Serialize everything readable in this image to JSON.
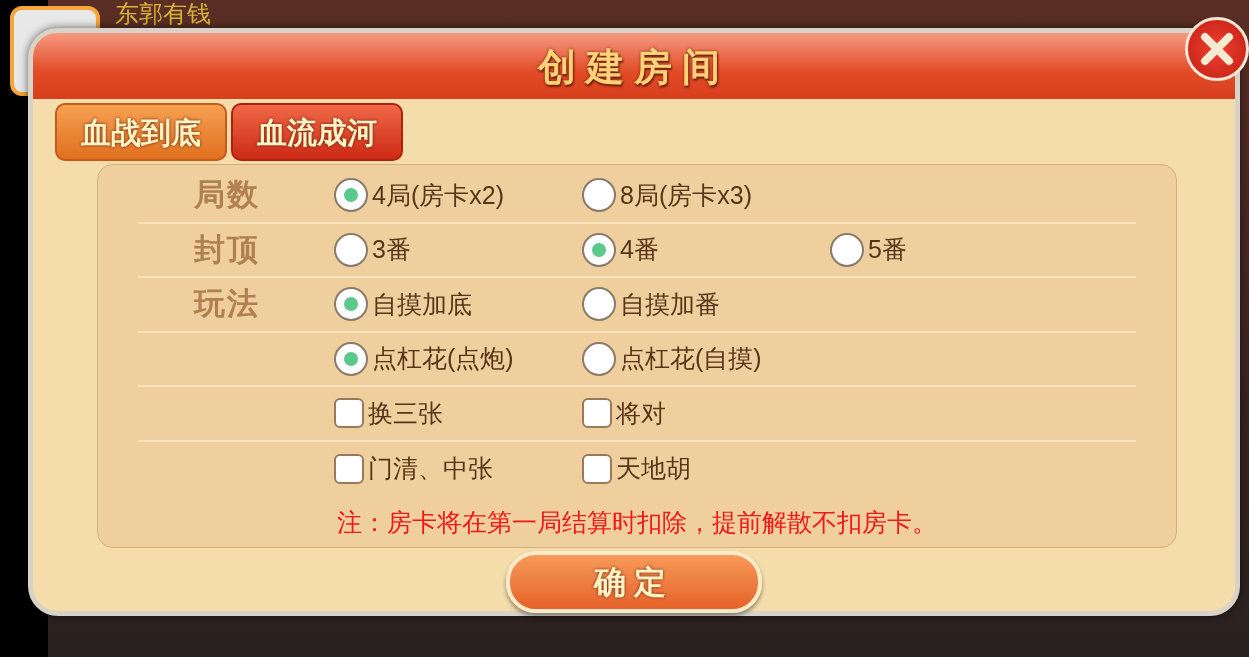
{
  "player": {
    "name": "东郭有钱"
  },
  "dialog": {
    "title": "创建房间",
    "tabs": [
      {
        "label": "血战到底",
        "selected": false
      },
      {
        "label": "血流成河",
        "selected": true
      }
    ],
    "rows": [
      {
        "label": "局数",
        "options": [
          {
            "kind": "radio",
            "label": "4局(房卡x2)",
            "selected": true
          },
          {
            "kind": "radio",
            "label": "8局(房卡x3)",
            "selected": false
          }
        ]
      },
      {
        "label": "封顶",
        "options": [
          {
            "kind": "radio",
            "label": "3番",
            "selected": false
          },
          {
            "kind": "radio",
            "label": "4番",
            "selected": true
          },
          {
            "kind": "radio",
            "label": "5番",
            "selected": false
          }
        ]
      },
      {
        "label": "玩法",
        "options": [
          {
            "kind": "radio",
            "label": "自摸加底",
            "selected": true
          },
          {
            "kind": "radio",
            "label": "自摸加番",
            "selected": false
          }
        ]
      },
      {
        "options": [
          {
            "kind": "radio",
            "label": "点杠花(点炮)",
            "selected": true
          },
          {
            "kind": "radio",
            "label": "点杠花(自摸)",
            "selected": false
          }
        ]
      },
      {
        "options": [
          {
            "kind": "checkbox",
            "label": "换三张",
            "checked": false
          },
          {
            "kind": "checkbox",
            "label": "将对",
            "checked": false
          }
        ]
      },
      {
        "options": [
          {
            "kind": "checkbox",
            "label": "门清、中张",
            "checked": false
          },
          {
            "kind": "checkbox",
            "label": "天地胡",
            "checked": false
          }
        ]
      }
    ],
    "note": "注：房卡将在第一局结算时扣除，提前解散不扣房卡。",
    "confirm": "确定"
  }
}
